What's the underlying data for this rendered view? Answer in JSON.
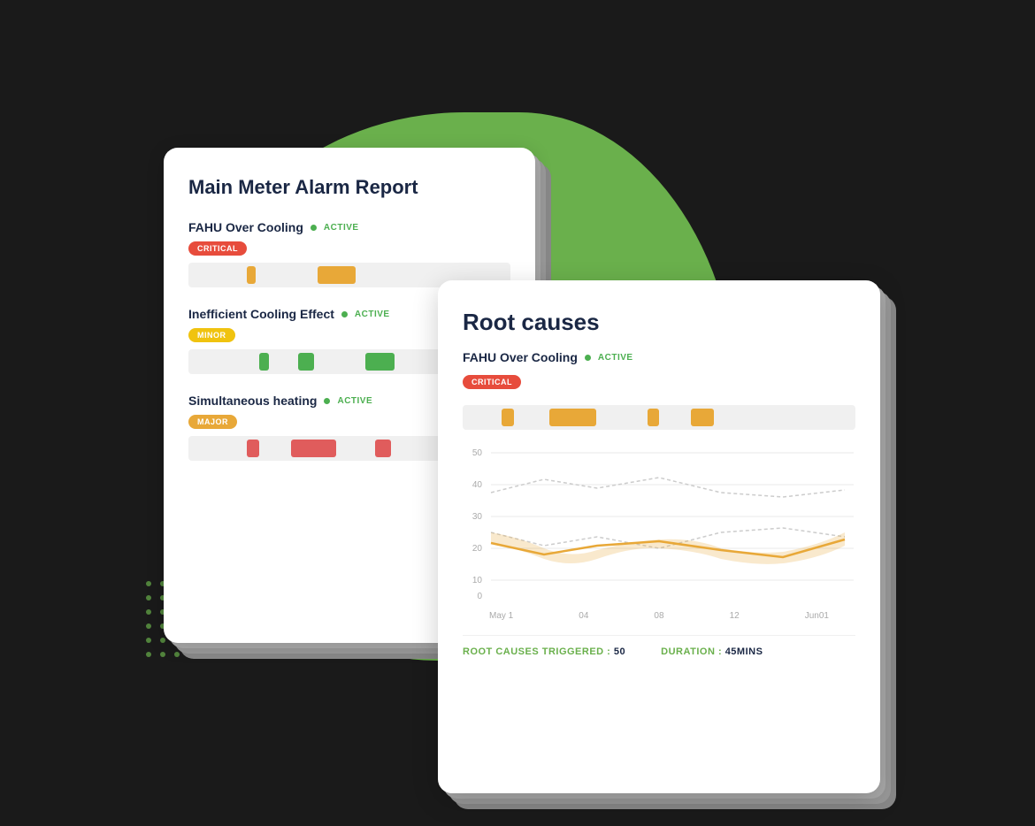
{
  "background": {
    "color": "#1a1a1a"
  },
  "back_card": {
    "title": "Main Meter Alarm Report",
    "alarms": [
      {
        "name": "FAHU Over Cooling",
        "status": "ACTIVE",
        "severity": "CRITICAL",
        "severity_class": "badge-critical",
        "bars": [
          {
            "left": "18%",
            "width": "3%",
            "color": "bar-orange"
          },
          {
            "left": "40%",
            "width": "12%",
            "color": "bar-orange"
          }
        ]
      },
      {
        "name": "Inefficient Cooling Effect",
        "status": "ACTIVE",
        "severity": "MINOR",
        "severity_class": "badge-minor",
        "bars": [
          {
            "left": "22%",
            "width": "3%",
            "color": "bar-green"
          },
          {
            "left": "34%",
            "width": "5%",
            "color": "bar-green"
          },
          {
            "left": "55%",
            "width": "9%",
            "color": "bar-green"
          }
        ]
      },
      {
        "name": "Simultaneous heating",
        "status": "ACTIVE",
        "severity": "MAJOR",
        "severity_class": "badge-major",
        "bars": [
          {
            "left": "18%",
            "width": "4%",
            "color": "bar-red"
          },
          {
            "left": "32%",
            "width": "14%",
            "color": "bar-red"
          },
          {
            "left": "58%",
            "width": "5%",
            "color": "bar-red"
          }
        ]
      }
    ]
  },
  "front_card": {
    "title": "Root causes",
    "alarm_name": "FAHU Over Cooling",
    "status": "ACTIVE",
    "severity": "CRITICAL",
    "severity_class": "badge-critical",
    "root_bars": [
      {
        "left": "10%",
        "width": "3%",
        "color": "bar-orange"
      },
      {
        "left": "22%",
        "width": "12%",
        "color": "bar-orange"
      },
      {
        "left": "47%",
        "width": "3%",
        "color": "bar-orange"
      },
      {
        "left": "58%",
        "width": "6%",
        "color": "bar-orange"
      }
    ],
    "chart": {
      "y_labels": [
        "50",
        "40",
        "30",
        "20",
        "10",
        "0"
      ],
      "x_labels": [
        "May 1",
        "04",
        "08",
        "12",
        "Jun01"
      ]
    },
    "stats": {
      "root_causes_label": "ROOT CAUSES TRIGGERED :",
      "root_causes_value": "50",
      "duration_label": "DURATION :",
      "duration_value": "45MINS"
    }
  }
}
